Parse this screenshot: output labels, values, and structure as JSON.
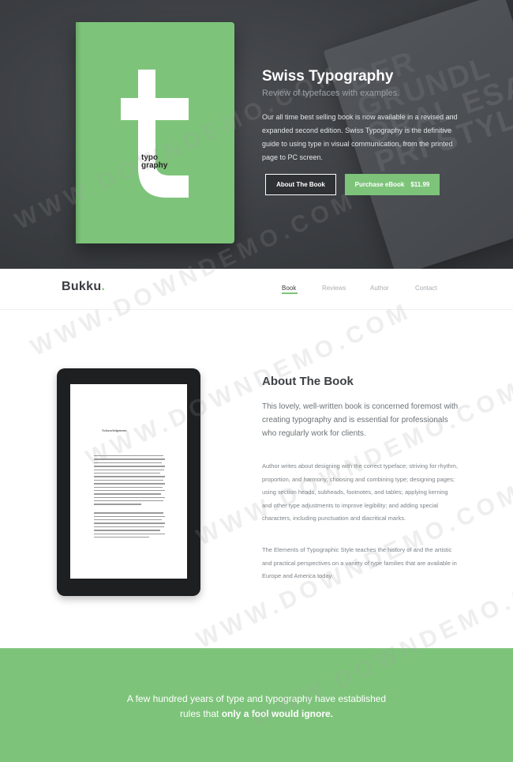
{
  "hero": {
    "background_text": "DER GRUNDL ORAL ESA PRI STYLE",
    "book_label_line1": "typo",
    "book_label_line2": "graphy",
    "title": "Swiss Typography",
    "subtitle": "Review of typefaces with examples.",
    "description": "Our all time best selling book is now available in a revised and expanded second edition. Swiss Typography is the definitive guide to using type in visual communication, from the printed page to PC screen.",
    "about_button": "About The Book",
    "purchase_button": "Purchase eBook",
    "price": "$11.99",
    "accent_color": "#7dc47a"
  },
  "nav": {
    "logo": "Bukku",
    "logo_dot": ".",
    "links": [
      "Book",
      "Reviews",
      "Author",
      "Contact"
    ],
    "active": "Book"
  },
  "about": {
    "screen_heading": "Acknowledgements",
    "title": "About The Book",
    "lead": "This lovely, well-written book is concerned foremost with creating typography and is essential for professionals who regularly work for clients.",
    "paragraph1": "Author writes about designing with the correct typeface; striving for rhythm, proportion, and harmony; choosing and combining type; designing pages; using section heads, subheads, footnotes, and tables; applying kerning and other type adjustments to improve legibility; and adding special characters, including punctuation and diacritical marks.",
    "paragraph2": "The Elements of Typographic Style teaches the history of and the artistic and practical perspectives on a variety of type families that are available in Europe and America today."
  },
  "quote": {
    "text": "A few hundred years of type and typography have established rules that",
    "strong": "only a fool would ignore."
  },
  "watermark": "WWW.DOWNDEMO.COM"
}
